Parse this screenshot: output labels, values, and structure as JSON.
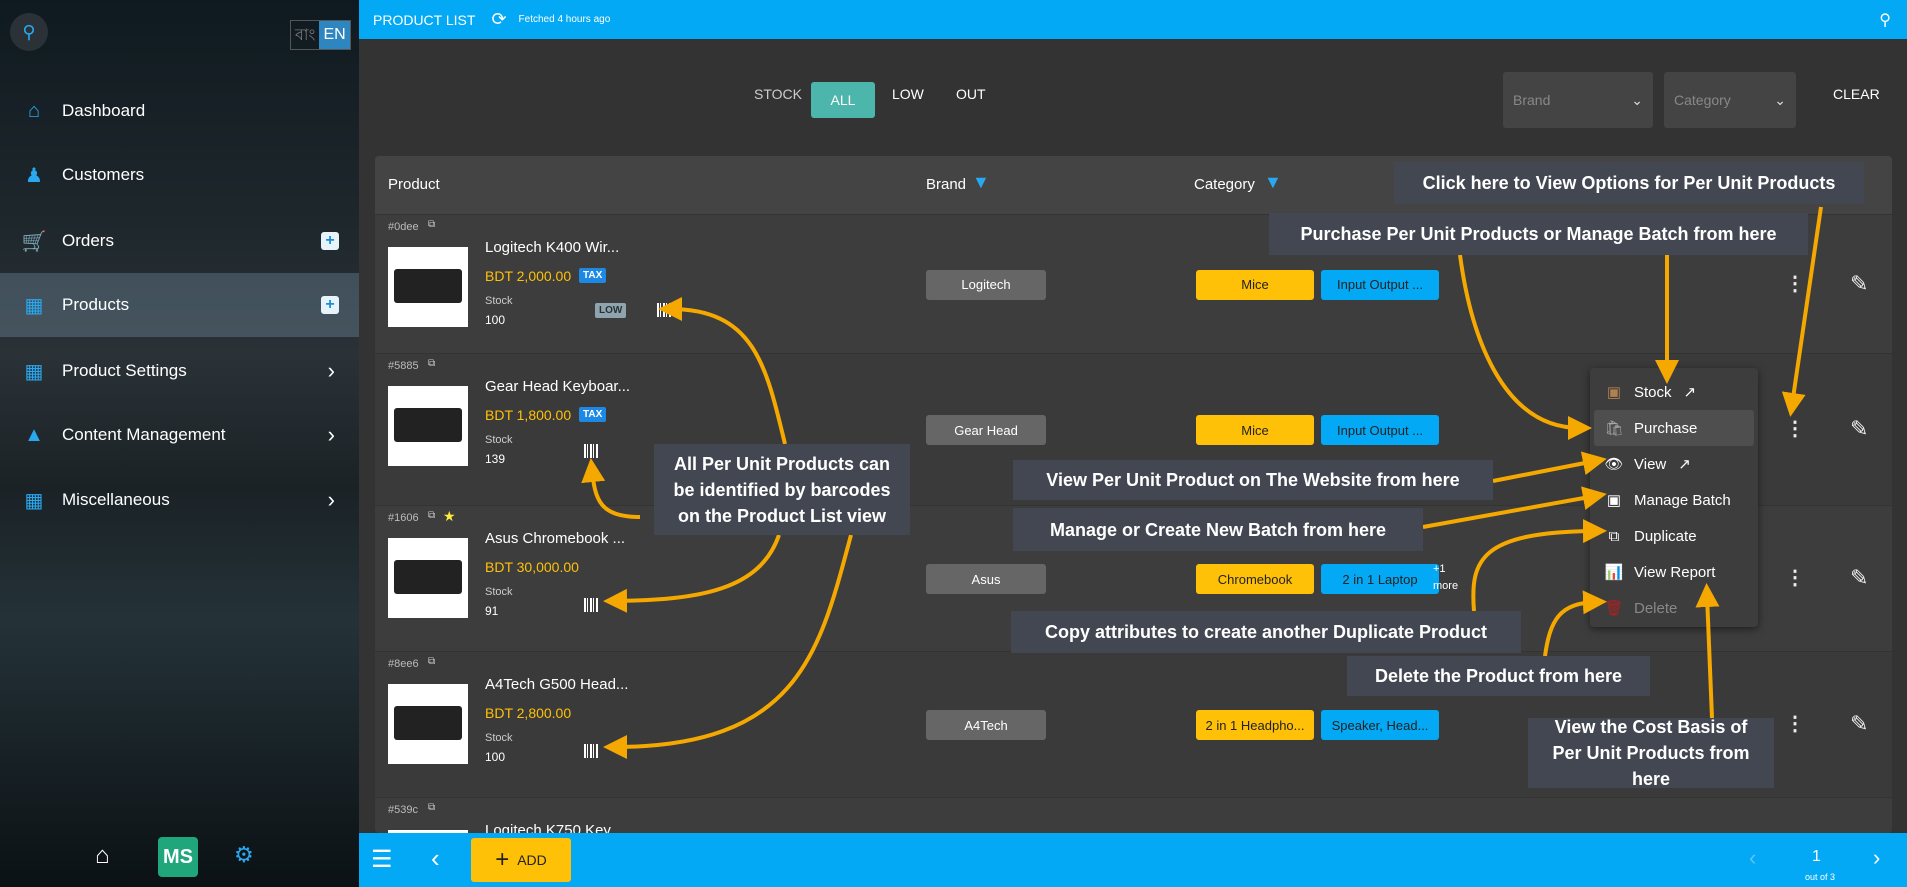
{
  "sidebar": {
    "lang_bn": "বাং",
    "lang_en": "EN",
    "items": [
      {
        "label": "Dashboard",
        "icon": "home-icon"
      },
      {
        "label": "Customers",
        "icon": "customers-icon"
      },
      {
        "label": "Orders",
        "icon": "orders-icon",
        "plus": "+"
      },
      {
        "label": "Products",
        "icon": "products-icon",
        "plus": "+",
        "active": true
      },
      {
        "label": "Product Settings",
        "icon": "product-settings-icon",
        "chevron": "›"
      },
      {
        "label": "Content Management",
        "icon": "content-icon",
        "chevron": "›"
      },
      {
        "label": "Miscellaneous",
        "icon": "misc-icon",
        "chevron": "›"
      }
    ],
    "logo": "MS"
  },
  "header": {
    "title": "PRODUCT LIST",
    "fetched": "Fetched 4 hours ago"
  },
  "filters": {
    "stock_label": "STOCK",
    "all": "ALL",
    "low": "LOW",
    "out": "OUT",
    "brand_placeholder": "Brand",
    "category_placeholder": "Category",
    "clear": "CLEAR"
  },
  "table": {
    "columns": [
      "Product",
      "Brand",
      "Category"
    ],
    "rows": [
      {
        "id": "#0dee",
        "name": "Logitech K400 Wir...",
        "price": "BDT 2,000.00",
        "tax": "TAX",
        "stock_label": "Stock",
        "stock": "100",
        "low": "LOW",
        "brand": "Logitech",
        "categories": [
          "Mice",
          "Input Output ..."
        ]
      },
      {
        "id": "#5885",
        "name": "Gear Head Keyboar...",
        "price": "BDT 1,800.00",
        "tax": "TAX",
        "stock_label": "Stock",
        "stock": "139",
        "brand": "Gear Head",
        "categories": [
          "Mice",
          "Input Output ..."
        ]
      },
      {
        "id": "#1606",
        "name": "Asus Chromebook ...",
        "price": "BDT 30,000.00",
        "stock_label": "Stock",
        "stock": "91",
        "brand": "Asus",
        "categories": [
          "Chromebook",
          "2 in 1 Laptop"
        ],
        "more": [
          "+1",
          "more"
        ],
        "starred": true
      },
      {
        "id": "#8ee6",
        "name": "A4Tech G500 Head...",
        "price": "BDT 2,800.00",
        "stock_label": "Stock",
        "stock": "100",
        "brand": "A4Tech",
        "categories": [
          "2 in 1 Headpho...",
          "Speaker, Head..."
        ]
      },
      {
        "id": "#539c",
        "name": "Logitech K750 Key..."
      }
    ]
  },
  "menu": {
    "items": [
      "Stock",
      "Purchase",
      "View",
      "Manage Batch",
      "Duplicate",
      "View Report",
      "Delete"
    ]
  },
  "annotations": {
    "view_options": "Click here to View Options for Per Unit Products",
    "purchase": "Purchase Per Unit Products or Manage Batch from here",
    "barcodes": "All Per Unit Products can be identified by barcodes on the Product List view",
    "view": "View Per Unit Product on The Website from here",
    "manage": "Manage or Create New Batch from here",
    "duplicate": "Copy attributes to create another Duplicate Product",
    "delete": "Delete the Product from here",
    "report": "View the Cost Basis of Per Unit Products from here"
  },
  "footer": {
    "add": "ADD",
    "page": "1",
    "out_of": "out of 3"
  },
  "colors": {
    "accent": "#03a9f4",
    "warning": "#ffc107",
    "annotation_arrow": "#f5a800",
    "teal": "#4db6ac"
  }
}
